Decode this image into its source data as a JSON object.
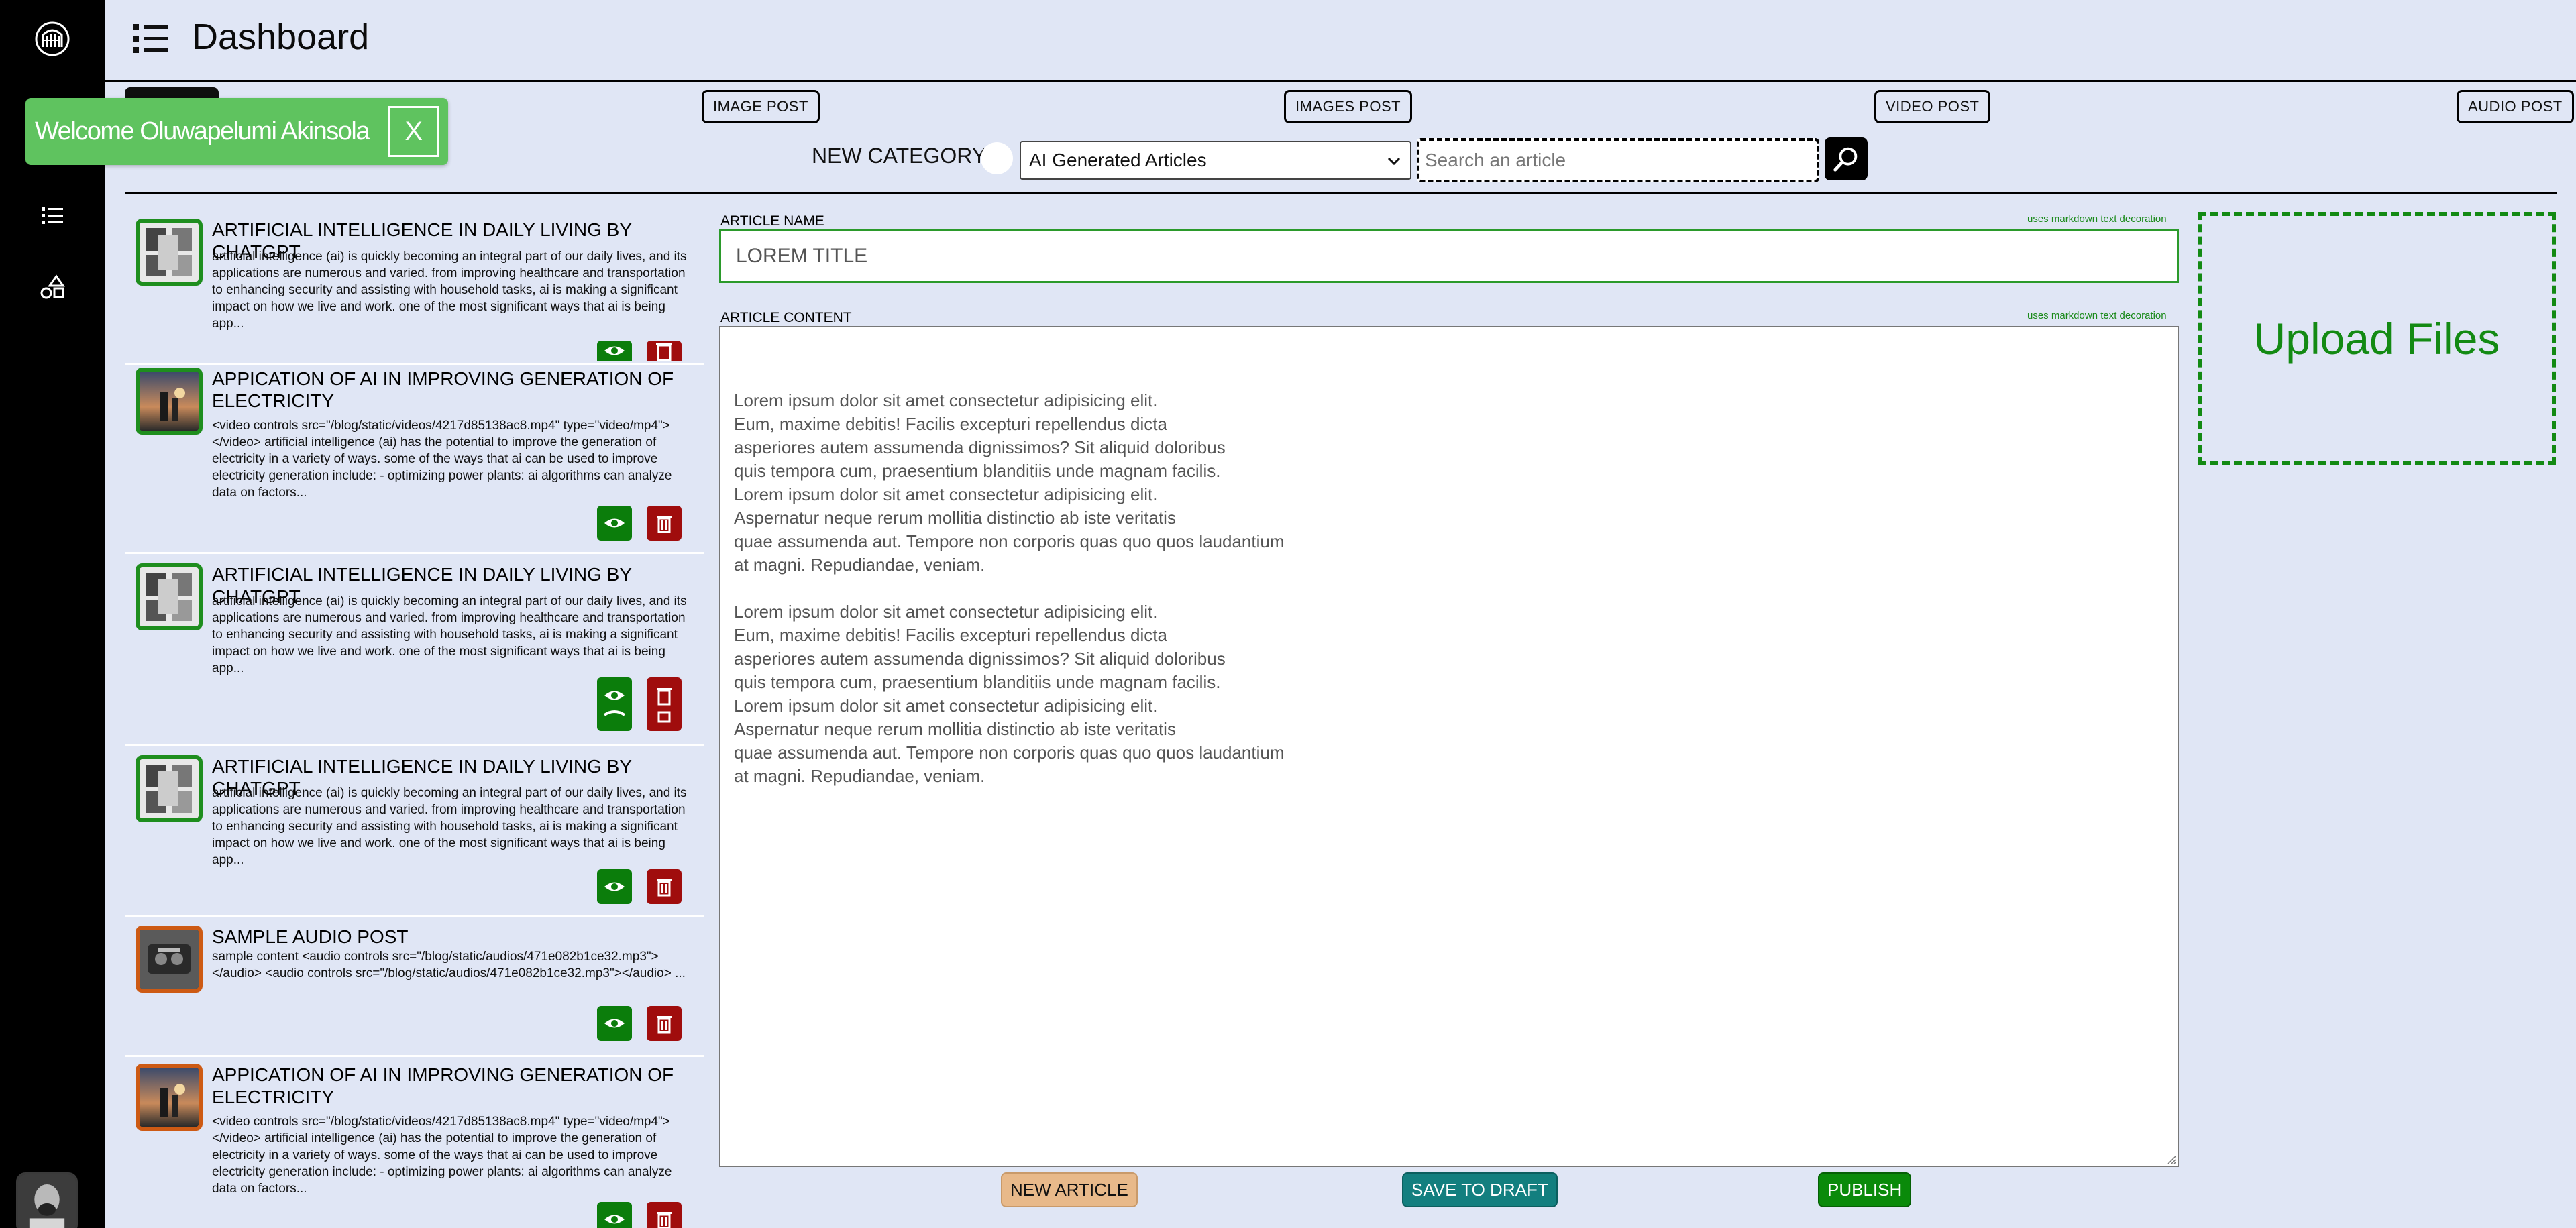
{
  "header": {
    "title": "Dashboard"
  },
  "post_types": [
    {
      "label": "IMAGE POST"
    },
    {
      "label": "IMAGES POST"
    },
    {
      "label": "VIDEO POST"
    },
    {
      "label": "AUDIO POST"
    }
  ],
  "toast": {
    "message": "Welcome Oluwapelumi Akinsola",
    "close_label": "X"
  },
  "category": {
    "new_category_label": "NEW CATEGORY",
    "selected": "AI Generated Articles"
  },
  "search": {
    "placeholder": "Search an article"
  },
  "articles": [
    {
      "title": "ARTIFICIAL INTELLIGENCE IN DAILY LIVING BY CHATGPT",
      "body": "artificial intelligence (ai) is quickly becoming an integral part of our daily lives, and its applications are numerous and varied. from improving healthcare and transportation to enhancing security and assisting with household tasks, ai is making a significant impact on how we live and work. one of the most significant ways that ai is being app...",
      "thumb": "image"
    },
    {
      "title": "APPICATION OF AI IN IMPROVING GENERATION OF ELECTRICITY",
      "body": "<video controls src=\"/blog/static/videos/4217d85138ac8.mp4\" type=\"video/mp4\"></video> artificial intelligence (ai) has the potential to improve the generation of electricity in a variety of ways. some of the ways that ai can be used to improve electricity generation include: - optimizing power plants: ai algorithms can analyze data on factors...",
      "thumb": "video"
    },
    {
      "title": "ARTIFICIAL INTELLIGENCE IN DAILY LIVING BY CHATGPT",
      "body": "artificial intelligence (ai) is quickly becoming an integral part of our daily lives, and its applications are numerous and varied. from improving healthcare and transportation to enhancing security and assisting with household tasks, ai is making a significant impact on how we live and work. one of the most significant ways that ai is being app...",
      "thumb": "image"
    },
    {
      "title": "ARTIFICIAL INTELLIGENCE IN DAILY LIVING BY CHATGPT",
      "body": "artificial intelligence (ai) is quickly becoming an integral part of our daily lives, and its applications are numerous and varied. from improving healthcare and transportation to enhancing security and assisting with household tasks, ai is making a significant impact on how we live and work. one of the most significant ways that ai is being app...",
      "thumb": "image"
    },
    {
      "title": "SAMPLE AUDIO POST",
      "body": "sample content <audio controls src=\"/blog/static/audios/471e082b1ce32.mp3\"></audio> <audio controls src=\"/blog/static/audios/471e082b1ce32.mp3\"></audio> ...",
      "thumb": "audio"
    },
    {
      "title": "APPICATION OF AI IN IMPROVING GENERATION OF ELECTRICITY",
      "body": "<video controls src=\"/blog/static/videos/4217d85138ac8.mp4\" type=\"video/mp4\"></video> artificial intelligence (ai) has the potential to improve the generation of electricity in a variety of ways. some of the ways that ai can be used to improve electricity generation include: - optimizing power plants: ai algorithms can analyze data on factors...",
      "thumb": "video"
    }
  ],
  "form": {
    "name_label": "ARTICLE NAME",
    "content_label": "ARTICLE CONTENT",
    "markdown_hint": "uses markdown text decoration",
    "title_placeholder": "LOREM TITLE",
    "content_text": "Lorem ipsum dolor sit amet consectetur adipisicing elit.\nEum, maxime debitis! Facilis excepturi repellendus dicta\nasperiores autem assumenda dignissimos? Sit aliquid doloribus\nquis tempora cum, praesentium blanditiis unde magnam facilis.\nLorem ipsum dolor sit amet consectetur adipisicing elit.\nAspernatur neque rerum mollitia distinctio ab iste veritatis\nquae assumenda aut. Tempore non corporis quas quo quos laudantium\nat magni. Repudiandae, veniam.\n\nLorem ipsum dolor sit amet consectetur adipisicing elit.\nEum, maxime debitis! Facilis excepturi repellendus dicta\nasperiores autem assumenda dignissimos? Sit aliquid doloribus\nquis tempora cum, praesentium blanditiis unde magnam facilis.\nLorem ipsum dolor sit amet consectetur adipisicing elit.\nAspernatur neque rerum mollitia distinctio ab iste veritatis\nquae assumenda aut. Tempore non corporis quas quo quos laudantium\nat magni. Repudiandae, veniam.",
    "upload_label": "Upload Files",
    "new_article_label": "NEW ARTICLE",
    "save_draft_label": "SAVE TO DRAFT",
    "publish_label": "PUBLISH"
  },
  "colors": {
    "background": "#e0e6f5",
    "sidebar": "#000000",
    "accent_green": "#138a13",
    "delete_red": "#a00d0d",
    "draft_teal": "#137f7f",
    "new_article_tan": "#e8b98a"
  },
  "icons": {
    "sidebar": [
      "logo-icon",
      "list-icon",
      "shapes-icon"
    ],
    "header": "menu-list-icon",
    "actions": [
      "eye-icon",
      "trash-icon"
    ]
  }
}
